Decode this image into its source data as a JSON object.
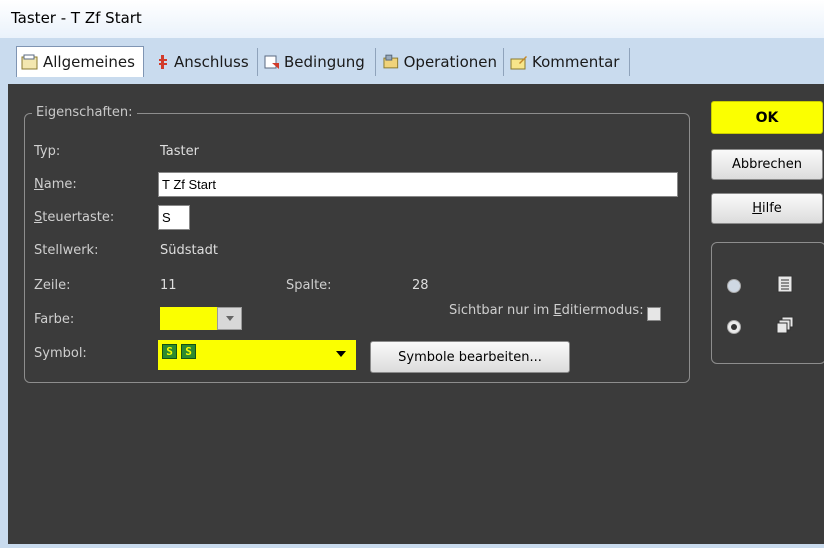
{
  "window": {
    "title": "Taster - T Zf Start"
  },
  "tabs": [
    {
      "label": "Allgemeines",
      "active": true
    },
    {
      "label": "Anschluss"
    },
    {
      "label": "Bedingung"
    },
    {
      "label": "Operationen"
    },
    {
      "label": "Kommentar"
    }
  ],
  "group": {
    "legend": "Eigenschaften:"
  },
  "fields": {
    "typ_label": "Typ:",
    "typ_value": "Taster",
    "name_label_pre": "",
    "name_label_u": "N",
    "name_label_post": "ame:",
    "name_value": "T Zf Start",
    "steuertaste_label_u": "S",
    "steuertaste_label_post": "teuertaste:",
    "steuertaste_value": "S",
    "stellwerk_label": "Stellwerk:",
    "stellwerk_value": "Südstadt",
    "zeile_label": "Zeile:",
    "zeile_value": "11",
    "spalte_label": "Spalte:",
    "spalte_value": "28",
    "farbe_label": "Farbe:",
    "farbe_color": "#fbff00",
    "sichtbar_pre": "Sichtbar nur im ",
    "sichtbar_u": "E",
    "sichtbar_post": "ditiermodus:",
    "symbol_label": "Symbol:",
    "symbol_glyph": "S"
  },
  "buttons": {
    "ok": "OK",
    "abbrechen": "Abbrechen",
    "hilfe_u": "H",
    "hilfe_post": "ilfe",
    "symbole": "Symbole bearbeiten..."
  },
  "colors": {
    "accent": "#fbff00",
    "panel": "#3b3b3b",
    "chrome": "#c9dbee"
  },
  "icons": [
    "tab-general-icon",
    "tab-connection-icon",
    "tab-condition-icon",
    "tab-operations-icon",
    "tab-comment-icon",
    "list-view-icon",
    "window-view-icon"
  ]
}
